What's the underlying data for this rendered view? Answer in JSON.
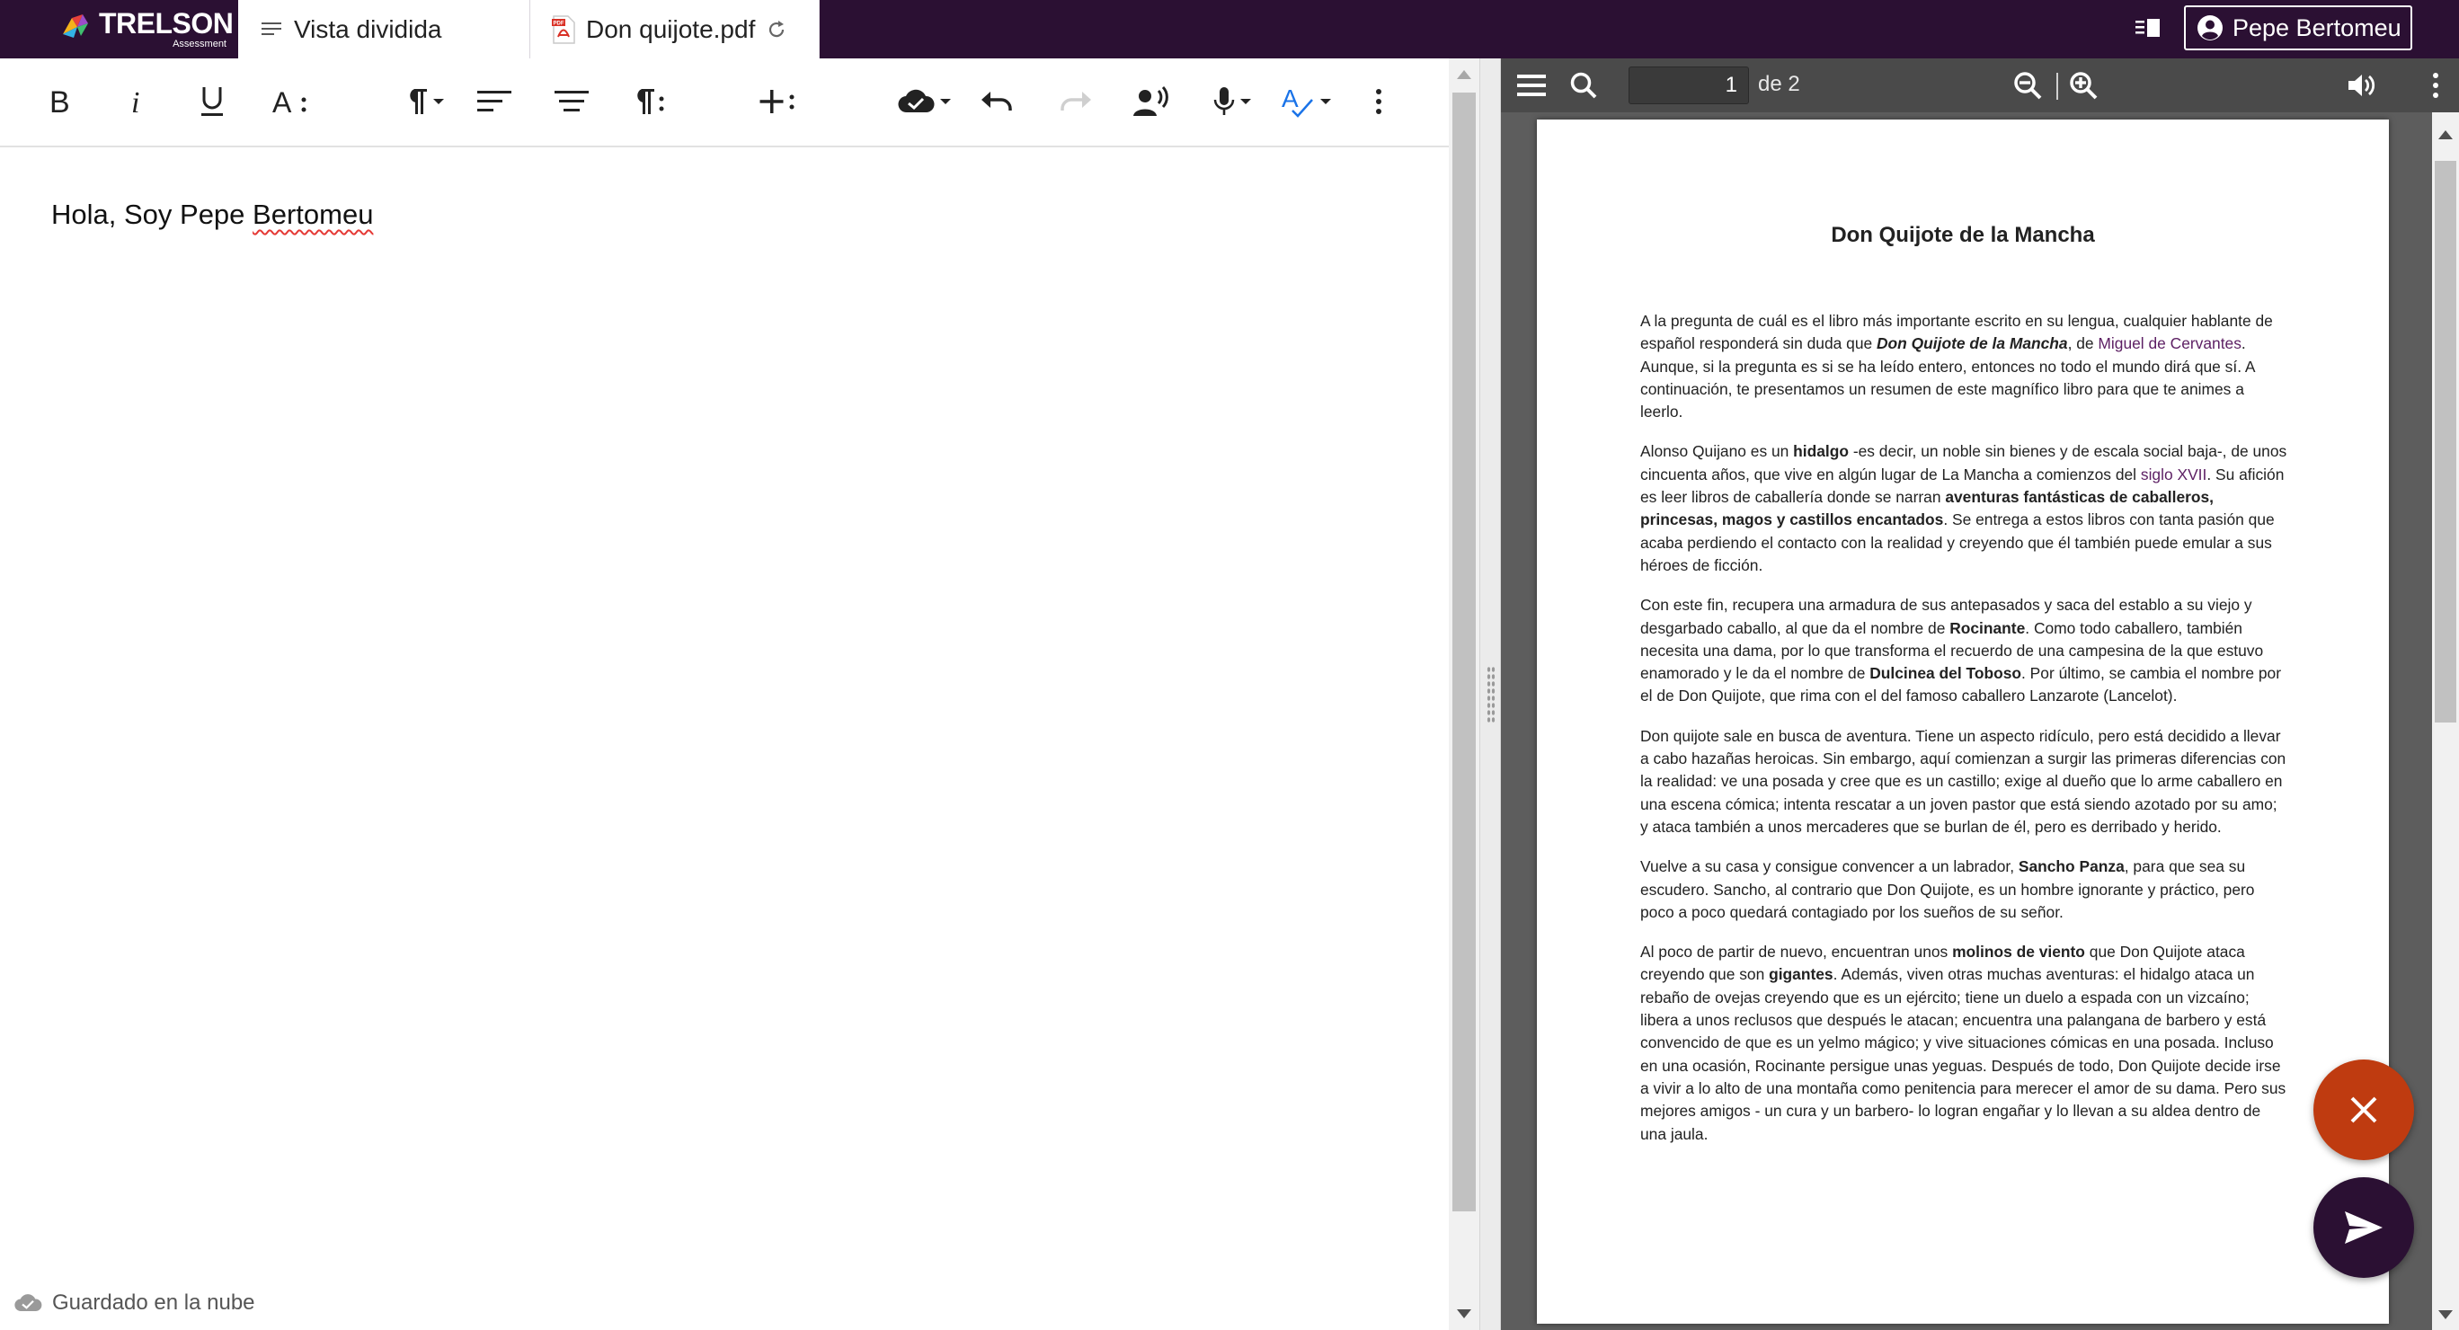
{
  "app": {
    "brand": "TRELSON",
    "brand_sub": "Assessment",
    "colors": {
      "header_bg": "#2b1033",
      "accent": "#5c1f63",
      "close_fab": "#bf3b10"
    }
  },
  "tabs": [
    {
      "label": "Vista dividida",
      "icon": "lines-icon"
    },
    {
      "label": "Don quijote.pdf",
      "icon": "pdf-file-icon"
    }
  ],
  "user": {
    "name": "Pepe Bertomeu"
  },
  "editor": {
    "content_before": "Hola, Soy Pepe ",
    "content_misspelled": "Bertomeu",
    "status": "Guardado en la nube"
  },
  "pdf_viewer": {
    "current_page": "1",
    "total_pages_label": "de 2"
  },
  "pdf_doc": {
    "title": "Don Quijote de la Mancha",
    "p1": {
      "a": "A la pregunta de cuál es el libro más importante escrito en su lengua, cualquier hablante de español responderá sin duda que ",
      "b": "Don Quijote de la Mancha",
      "c": ", de ",
      "d": "Miguel de Cervantes",
      "e": ". Aunque, si la pregunta es si se ha leído entero, entonces no todo el mundo dirá que sí. A continuación, te presentamos un resumen de este magnífico libro para que te animes a leerlo."
    },
    "p2": {
      "a": "Alonso Quijano es un ",
      "b": "hidalgo",
      "c": " -es decir, un noble sin bienes y de escala social baja-, de unos cincuenta años, que vive en algún lugar de La Mancha a comienzos del ",
      "d": "siglo XVII",
      "e": ". Su afición es leer libros de caballería donde se narran ",
      "f": "aventuras fantásticas de caballeros, princesas, magos y castillos encantados",
      "g": ". Se entrega a estos libros con tanta pasión que acaba perdiendo el contacto con la realidad y creyendo que él también puede emular a sus héroes de ficción."
    },
    "p3": {
      "a": "Con este fin, recupera una armadura de sus antepasados y saca del establo a su viejo y desgarbado caballo, al que da el nombre de ",
      "b": "Rocinante",
      "c": ". Como todo caballero, también necesita una dama, por lo que transforma el recuerdo de una campesina de la que estuvo enamorado y le da el nombre de ",
      "d": "Dulcinea del Toboso",
      "e": ". Por último, se cambia el nombre por el de Don Quijote, que rima con el del famoso caballero Lanzarote (Lancelot)."
    },
    "p4": "Don quijote sale en busca de aventura. Tiene un aspecto ridículo, pero está decidido a llevar a cabo hazañas heroicas. Sin embargo, aquí comienzan a surgir las primeras diferencias con la realidad: ve una posada y cree que es un castillo; exige al dueño que lo arme caballero en una escena cómica; intenta rescatar a un joven pastor que está siendo azotado por su amo; y ataca también a unos mercaderes que se burlan de él, pero es derribado y herido.",
    "p5": {
      "a": "Vuelve a su casa y consigue convencer a un labrador, ",
      "b": "Sancho Panza",
      "c": ", para que sea su escudero. Sancho, al contrario que Don Quijote, es un hombre ignorante y práctico, pero poco a poco quedará contagiado por los sueños de su señor."
    },
    "p6": {
      "a": "Al poco de partir de nuevo, encuentran unos ",
      "b": "molinos de viento",
      "c": " que Don Quijote ataca creyendo que son ",
      "d": "gigantes",
      "e": ". Además, viven otras muchas aventuras: el hidalgo ataca un rebaño de ovejas creyendo que es un ejército; tiene un duelo a espada con un vizcaíno; libera a unos reclusos que después le atacan; encuentra una palangana de barbero y está convencido de que es un yelmo mágico; y vive situaciones cómicas en una posada. Incluso en una ocasión, Rocinante persigue unas yeguas. Después de todo, Don Quijote decide irse a vivir a lo alto de una montaña como penitencia para merecer el amor de su dama. Pero sus mejores amigos - un cura y un barbero- lo logran engañar y lo llevan a su aldea dentro de una jaula."
    }
  }
}
